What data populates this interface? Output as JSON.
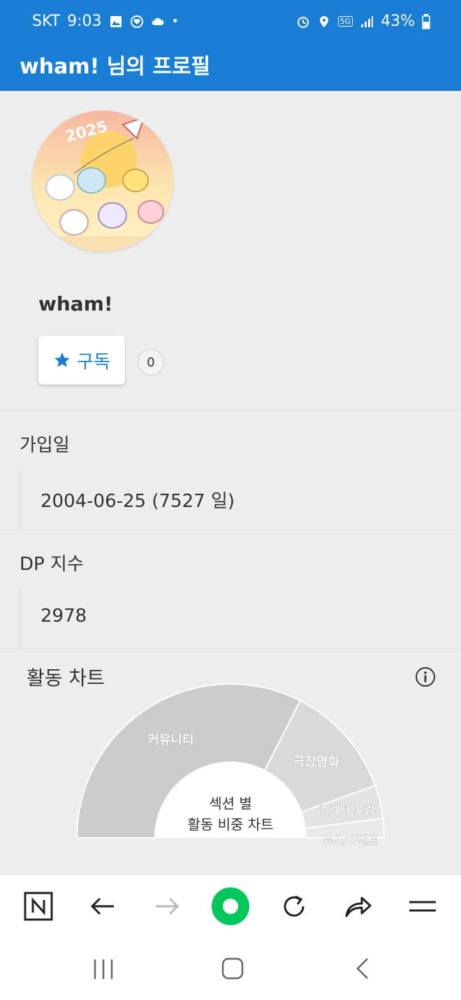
{
  "status_bar": {
    "carrier": "SKT",
    "time": "9:03",
    "dot": "•",
    "network": "5G",
    "battery": "43%"
  },
  "header": {
    "title": "wham! 님의 프로필"
  },
  "profile": {
    "username": "wham!",
    "subscribe_label": "구독",
    "subscriber_count": "0",
    "avatar_text": "2025"
  },
  "join_date": {
    "label": "가입일",
    "value": "2004-06-25 (7527 일)"
  },
  "dp_index": {
    "label": "DP 지수",
    "value": "2978"
  },
  "activity_chart": {
    "title": "활동 차트",
    "center_line1": "섹션 별",
    "center_line2": "활동 비중 차트"
  },
  "chart_data": {
    "type": "pie",
    "title": "활동 차트",
    "subtitle": "섹션 별 활동 비중 차트",
    "categories": [
      "커뮤니티",
      "극장영화",
      "컬렉터 포럼",
      "뉴스/이벤트"
    ],
    "values": [
      65,
      24,
      7,
      4
    ],
    "colors": [
      "#cccccc",
      "#d9d9d9",
      "#e3e3e3",
      "#e9e9e9"
    ],
    "shape": "semicircle-donut",
    "legend": "none"
  },
  "bottom_nav": {
    "items": [
      "naver-n-icon",
      "back-arrow-icon",
      "forward-arrow-icon",
      "home-green-icon",
      "reload-icon",
      "share-icon",
      "menu-icon"
    ]
  },
  "colors": {
    "primary": "#1a7fd4",
    "green": "#03c75a"
  }
}
